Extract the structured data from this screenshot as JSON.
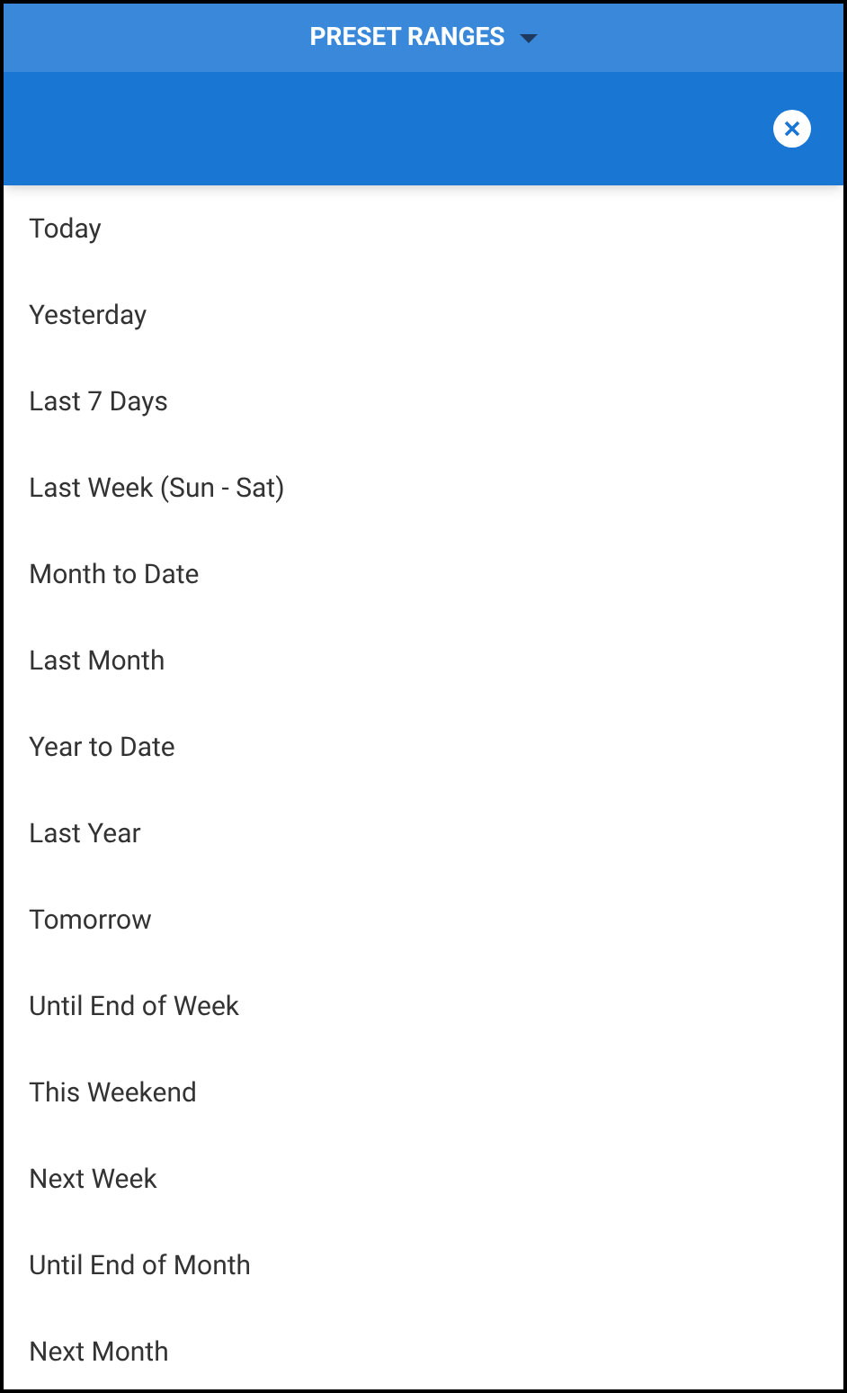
{
  "header": {
    "title": "PRESET RANGES"
  },
  "ranges": [
    {
      "label": "Today"
    },
    {
      "label": "Yesterday"
    },
    {
      "label": "Last 7 Days"
    },
    {
      "label": "Last Week (Sun - Sat)"
    },
    {
      "label": "Month to Date"
    },
    {
      "label": "Last Month"
    },
    {
      "label": "Year to Date"
    },
    {
      "label": "Last Year"
    },
    {
      "label": "Tomorrow"
    },
    {
      "label": "Until End of Week"
    },
    {
      "label": "This Weekend"
    },
    {
      "label": "Next Week"
    },
    {
      "label": "Until End of Month"
    },
    {
      "label": "Next Month"
    }
  ]
}
